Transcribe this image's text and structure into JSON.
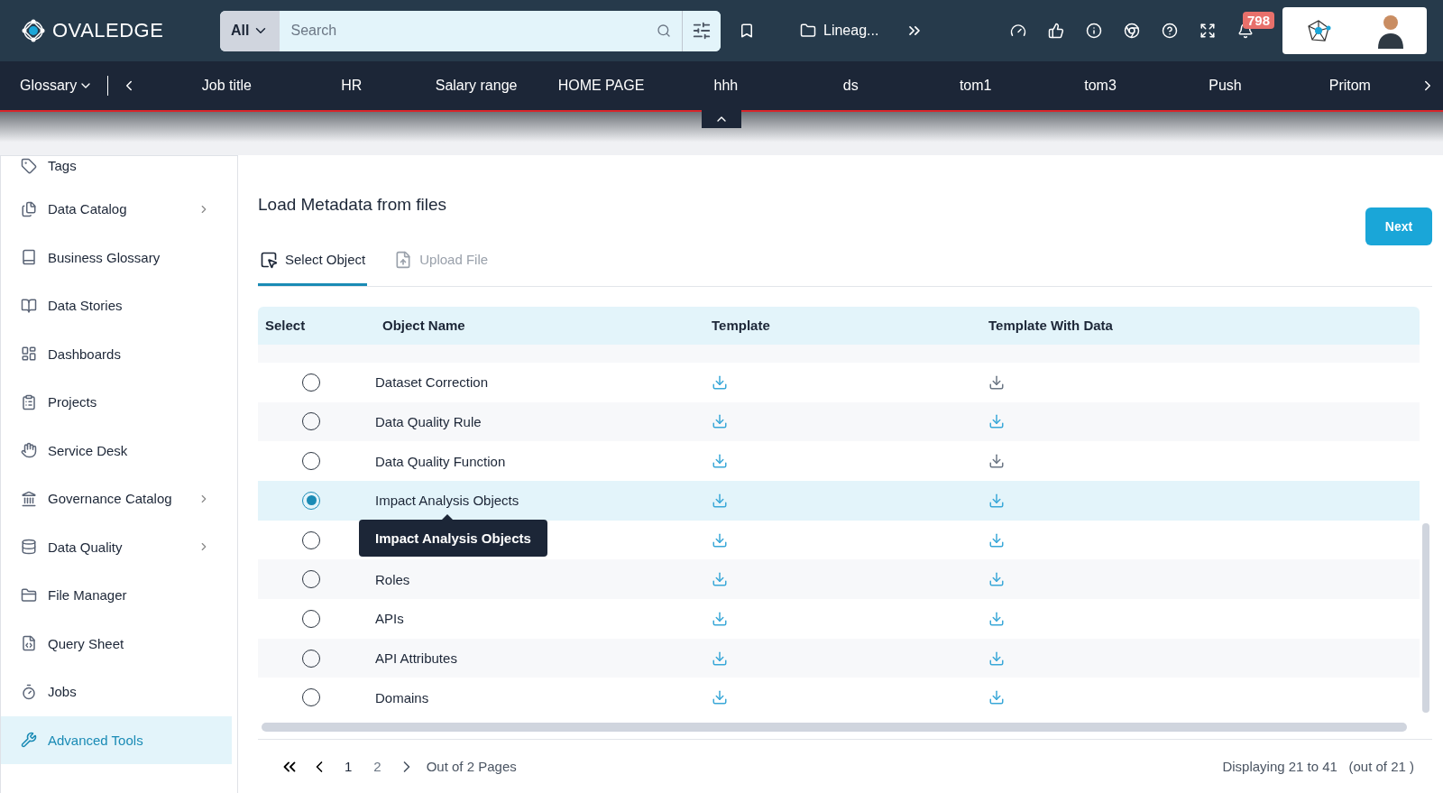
{
  "header": {
    "logo": "OVALEDGE",
    "search": {
      "scope": "All",
      "placeholder": "Search"
    },
    "recent": "Lineag...",
    "notifications": "798"
  },
  "nav": {
    "menu": "Glossary",
    "items": [
      "Job title",
      "HR",
      "Salary range",
      "HOME PAGE",
      "hhh",
      "ds",
      "tom1",
      "tom3",
      "Push",
      "Pritom"
    ]
  },
  "sidebar": {
    "items": [
      {
        "label": "Tags",
        "has_children": false,
        "selected": false
      },
      {
        "label": "Data Catalog",
        "has_children": true,
        "selected": false
      },
      {
        "label": "Business Glossary",
        "has_children": false,
        "selected": false
      },
      {
        "label": "Data Stories",
        "has_children": false,
        "selected": false
      },
      {
        "label": "Dashboards",
        "has_children": false,
        "selected": false
      },
      {
        "label": "Projects",
        "has_children": false,
        "selected": false
      },
      {
        "label": "Service Desk",
        "has_children": false,
        "selected": false
      },
      {
        "label": "Governance Catalog",
        "has_children": true,
        "selected": false
      },
      {
        "label": "Data Quality",
        "has_children": true,
        "selected": false
      },
      {
        "label": "File Manager",
        "has_children": false,
        "selected": false
      },
      {
        "label": "Query Sheet",
        "has_children": false,
        "selected": false
      },
      {
        "label": "Jobs",
        "has_children": false,
        "selected": false
      },
      {
        "label": "Advanced Tools",
        "has_children": false,
        "selected": true
      }
    ]
  },
  "page": {
    "title": "Load Metadata from files",
    "next_button": "Next",
    "tabs": [
      {
        "label": "Select Object",
        "selected": true
      },
      {
        "label": "Upload File",
        "selected": false
      }
    ]
  },
  "table": {
    "columns": [
      "Select",
      "Object Name",
      "Template",
      "Template With Data"
    ],
    "rows": [
      {
        "name": "Dataset Correction",
        "selected": false,
        "data_template_enabled": false
      },
      {
        "name": "Data Quality Rule",
        "selected": false,
        "data_template_enabled": true
      },
      {
        "name": "Data Quality Function",
        "selected": false,
        "data_template_enabled": false
      },
      {
        "name": "Impact Analysis Objects",
        "selected": true,
        "data_template_enabled": true,
        "tooltip": "Impact Analysis Objects"
      },
      {
        "selected": false,
        "data_template_enabled": true
      },
      {
        "name": "Roles",
        "selected": false,
        "data_template_enabled": true
      },
      {
        "name": "APIs",
        "selected": false,
        "data_template_enabled": true
      },
      {
        "name": "API Attributes",
        "selected": false,
        "data_template_enabled": true
      },
      {
        "name": "Domains",
        "selected": false,
        "data_template_enabled": true
      }
    ]
  },
  "pagination": {
    "pages": [
      {
        "label": "1",
        "selected": true
      },
      {
        "label": "2",
        "selected": false
      }
    ],
    "summary": "Out of 2 Pages",
    "displaying": "Displaying 21 to 41   (out of 21 )"
  }
}
